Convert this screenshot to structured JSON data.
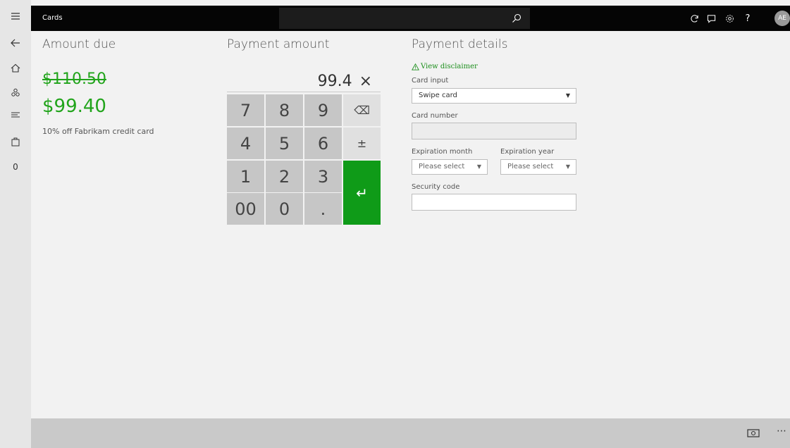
{
  "header": {
    "title": "Cards",
    "avatar_initials": "AE"
  },
  "rail": {
    "icons": [
      "menu-icon",
      "back-icon",
      "home-icon",
      "products-icon",
      "transactions-icon",
      "cart-icon",
      "count"
    ],
    "count": "0"
  },
  "topbar_icons": [
    "refresh-icon",
    "chat-icon",
    "settings-icon",
    "help-icon"
  ],
  "help_label": "?",
  "amount_due": {
    "title": "Amount due",
    "original": "$110.50",
    "discounted": "$99.40",
    "discount_note": "10% off Fabrikam credit card"
  },
  "payment_amount": {
    "title": "Payment amount",
    "value": "99.4",
    "clear": "×",
    "keys": [
      "7",
      "8",
      "9",
      "4",
      "5",
      "6",
      "1",
      "2",
      "3",
      "00",
      "0",
      "."
    ],
    "backspace": "⌫",
    "plusminus": "±",
    "enter": "↵"
  },
  "payment_details": {
    "title": "Payment details",
    "disclaimer": "View disclaimer",
    "card_input_label": "Card input",
    "card_input_value": "Swipe card",
    "card_number_label": "Card number",
    "card_number_value": "",
    "exp_month_label": "Expiration month",
    "exp_month_value": "Please select",
    "exp_year_label": "Expiration year",
    "exp_year_value": "Please select",
    "security_code_label": "Security code",
    "security_code_value": ""
  },
  "colors": {
    "accent": "#21a41b",
    "enter": "#0f9b18",
    "topbar": "#050505"
  },
  "bottombar": {
    "icons": [
      "cash-icon",
      "more-icon"
    ],
    "more": "⋯"
  }
}
